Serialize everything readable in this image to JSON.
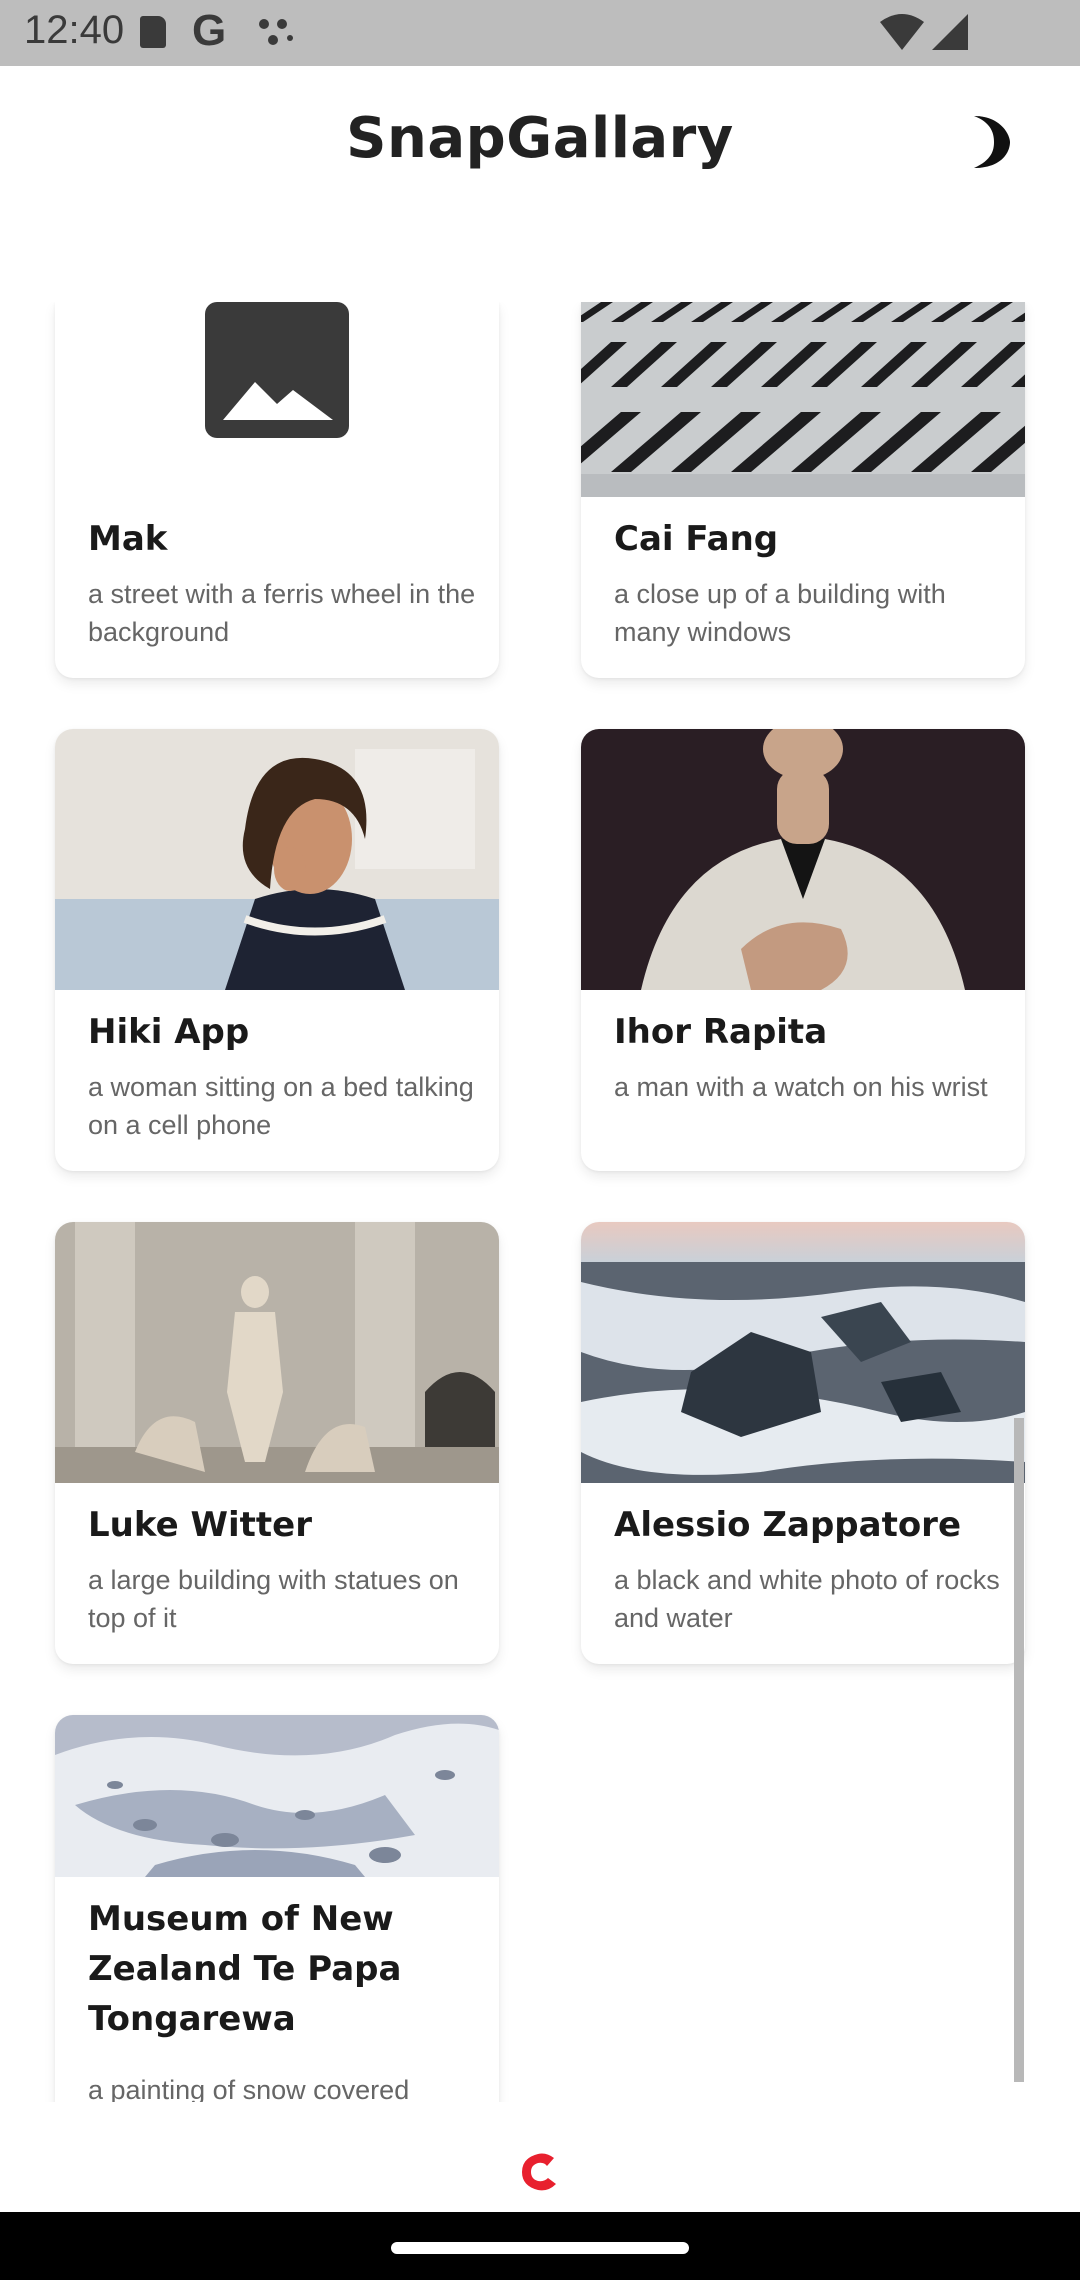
{
  "status": {
    "time": "12:40",
    "google_letter": "G"
  },
  "app": {
    "title": "SnapGallary"
  },
  "cards": [
    {
      "author": "Mak",
      "description": "a street with a ferris wheel in the background"
    },
    {
      "author": "Cai Fang",
      "description": "a close up of a building with many windows"
    },
    {
      "author": "Hiki App",
      "description": "a woman sitting on a bed talking on a cell phone"
    },
    {
      "author": "Ihor Rapita",
      "description": "a man with a watch on his wrist"
    },
    {
      "author": "Luke Witter",
      "description": "a large building with statues on top of it"
    },
    {
      "author": "Alessio Zappatore",
      "description": "a black and white photo of rocks and water"
    },
    {
      "author": "Museum of New Zealand Te Papa Tongarewa",
      "description": "a painting of snow covered"
    }
  ],
  "colors": {
    "status_bar": "#bdbdbd",
    "accent_logo": "#e8202e",
    "text_primary": "#1a1a1a",
    "text_secondary": "#666666"
  },
  "icons": {
    "theme_toggle": "half-moon-icon",
    "placeholder": "image-placeholder-icon",
    "bottom_logo": "brand-c-icon"
  }
}
